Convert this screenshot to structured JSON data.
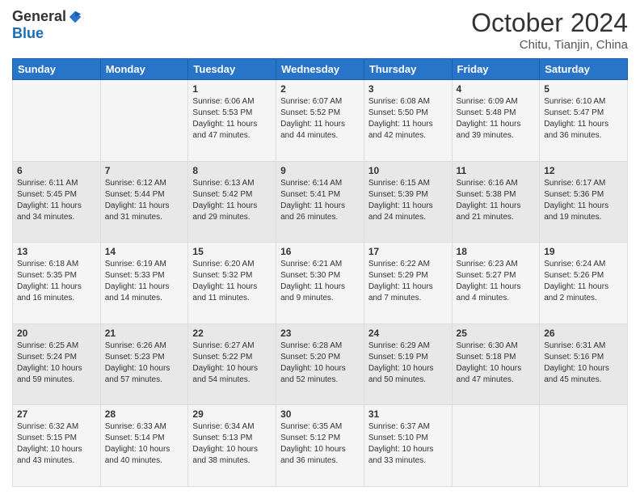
{
  "header": {
    "logo_general": "General",
    "logo_blue": "Blue",
    "month_title": "October 2024",
    "location": "Chitu, Tianjin, China"
  },
  "days_of_week": [
    "Sunday",
    "Monday",
    "Tuesday",
    "Wednesday",
    "Thursday",
    "Friday",
    "Saturday"
  ],
  "weeks": [
    [
      {
        "day": "",
        "info": ""
      },
      {
        "day": "",
        "info": ""
      },
      {
        "day": "1",
        "sunrise": "6:06 AM",
        "sunset": "5:53 PM",
        "daylight": "11 hours and 47 minutes."
      },
      {
        "day": "2",
        "sunrise": "6:07 AM",
        "sunset": "5:52 PM",
        "daylight": "11 hours and 44 minutes."
      },
      {
        "day": "3",
        "sunrise": "6:08 AM",
        "sunset": "5:50 PM",
        "daylight": "11 hours and 42 minutes."
      },
      {
        "day": "4",
        "sunrise": "6:09 AM",
        "sunset": "5:48 PM",
        "daylight": "11 hours and 39 minutes."
      },
      {
        "day": "5",
        "sunrise": "6:10 AM",
        "sunset": "5:47 PM",
        "daylight": "11 hours and 36 minutes."
      }
    ],
    [
      {
        "day": "6",
        "sunrise": "6:11 AM",
        "sunset": "5:45 PM",
        "daylight": "11 hours and 34 minutes."
      },
      {
        "day": "7",
        "sunrise": "6:12 AM",
        "sunset": "5:44 PM",
        "daylight": "11 hours and 31 minutes."
      },
      {
        "day": "8",
        "sunrise": "6:13 AM",
        "sunset": "5:42 PM",
        "daylight": "11 hours and 29 minutes."
      },
      {
        "day": "9",
        "sunrise": "6:14 AM",
        "sunset": "5:41 PM",
        "daylight": "11 hours and 26 minutes."
      },
      {
        "day": "10",
        "sunrise": "6:15 AM",
        "sunset": "5:39 PM",
        "daylight": "11 hours and 24 minutes."
      },
      {
        "day": "11",
        "sunrise": "6:16 AM",
        "sunset": "5:38 PM",
        "daylight": "11 hours and 21 minutes."
      },
      {
        "day": "12",
        "sunrise": "6:17 AM",
        "sunset": "5:36 PM",
        "daylight": "11 hours and 19 minutes."
      }
    ],
    [
      {
        "day": "13",
        "sunrise": "6:18 AM",
        "sunset": "5:35 PM",
        "daylight": "11 hours and 16 minutes."
      },
      {
        "day": "14",
        "sunrise": "6:19 AM",
        "sunset": "5:33 PM",
        "daylight": "11 hours and 14 minutes."
      },
      {
        "day": "15",
        "sunrise": "6:20 AM",
        "sunset": "5:32 PM",
        "daylight": "11 hours and 11 minutes."
      },
      {
        "day": "16",
        "sunrise": "6:21 AM",
        "sunset": "5:30 PM",
        "daylight": "11 hours and 9 minutes."
      },
      {
        "day": "17",
        "sunrise": "6:22 AM",
        "sunset": "5:29 PM",
        "daylight": "11 hours and 7 minutes."
      },
      {
        "day": "18",
        "sunrise": "6:23 AM",
        "sunset": "5:27 PM",
        "daylight": "11 hours and 4 minutes."
      },
      {
        "day": "19",
        "sunrise": "6:24 AM",
        "sunset": "5:26 PM",
        "daylight": "11 hours and 2 minutes."
      }
    ],
    [
      {
        "day": "20",
        "sunrise": "6:25 AM",
        "sunset": "5:24 PM",
        "daylight": "10 hours and 59 minutes."
      },
      {
        "day": "21",
        "sunrise": "6:26 AM",
        "sunset": "5:23 PM",
        "daylight": "10 hours and 57 minutes."
      },
      {
        "day": "22",
        "sunrise": "6:27 AM",
        "sunset": "5:22 PM",
        "daylight": "10 hours and 54 minutes."
      },
      {
        "day": "23",
        "sunrise": "6:28 AM",
        "sunset": "5:20 PM",
        "daylight": "10 hours and 52 minutes."
      },
      {
        "day": "24",
        "sunrise": "6:29 AM",
        "sunset": "5:19 PM",
        "daylight": "10 hours and 50 minutes."
      },
      {
        "day": "25",
        "sunrise": "6:30 AM",
        "sunset": "5:18 PM",
        "daylight": "10 hours and 47 minutes."
      },
      {
        "day": "26",
        "sunrise": "6:31 AM",
        "sunset": "5:16 PM",
        "daylight": "10 hours and 45 minutes."
      }
    ],
    [
      {
        "day": "27",
        "sunrise": "6:32 AM",
        "sunset": "5:15 PM",
        "daylight": "10 hours and 43 minutes."
      },
      {
        "day": "28",
        "sunrise": "6:33 AM",
        "sunset": "5:14 PM",
        "daylight": "10 hours and 40 minutes."
      },
      {
        "day": "29",
        "sunrise": "6:34 AM",
        "sunset": "5:13 PM",
        "daylight": "10 hours and 38 minutes."
      },
      {
        "day": "30",
        "sunrise": "6:35 AM",
        "sunset": "5:12 PM",
        "daylight": "10 hours and 36 minutes."
      },
      {
        "day": "31",
        "sunrise": "6:37 AM",
        "sunset": "5:10 PM",
        "daylight": "10 hours and 33 minutes."
      },
      {
        "day": "",
        "info": ""
      },
      {
        "day": "",
        "info": ""
      }
    ]
  ],
  "labels": {
    "sunrise": "Sunrise: ",
    "sunset": "Sunset: ",
    "daylight": "Daylight: "
  }
}
